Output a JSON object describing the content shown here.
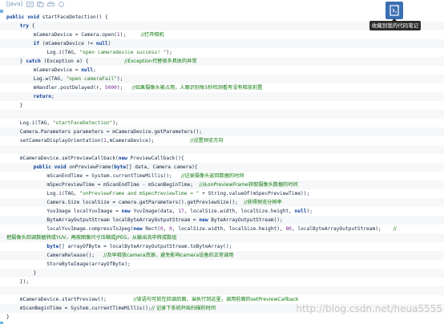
{
  "toolbar": {
    "lang_tag": "[java]",
    "icons": [
      "view-plain-icon",
      "copy-icon",
      "print-icon",
      "help-icon"
    ]
  },
  "collect": {
    "icon": "collect-code-icon",
    "tooltip": "收藏到我的代码笔记"
  },
  "watermark": "http://blog.csdn.net/heua5555",
  "code_lines": [
    {
      "indent": 0,
      "tokens": [
        [
          "kw",
          "public "
        ],
        [
          "kw",
          "void "
        ],
        [
          "pl",
          "startFaceDetection() {"
        ]
      ]
    },
    {
      "indent": 4,
      "tokens": [
        [
          "kw",
          "try "
        ],
        [
          "pl",
          "{"
        ]
      ]
    },
    {
      "indent": 8,
      "tokens": [
        [
          "pl",
          "mCameraDevice = Camera.open("
        ],
        [
          "num",
          "1"
        ],
        [
          "pl",
          ");     "
        ],
        [
          "cm",
          "//打开相机"
        ]
      ]
    },
    {
      "indent": 8,
      "tokens": [
        [
          "kw",
          "if "
        ],
        [
          "pl",
          "(mCameraDevice != "
        ],
        [
          "kw",
          "null"
        ],
        [
          "pl",
          ")"
        ]
      ]
    },
    {
      "indent": 12,
      "tokens": [
        [
          "pl",
          "Log.i(TAG, "
        ],
        [
          "str",
          "\"open cameradevice success! \""
        ],
        [
          "pl",
          ");"
        ]
      ]
    },
    {
      "indent": 4,
      "tokens": [
        [
          "pl",
          "} "
        ],
        [
          "kw",
          "catch "
        ],
        [
          "pl",
          "(Exception e) {            "
        ],
        [
          "cm",
          "//Exception代替很多具体的异常"
        ]
      ]
    },
    {
      "indent": 8,
      "tokens": [
        [
          "pl",
          "mCameraDevice = "
        ],
        [
          "kw",
          "null"
        ],
        [
          "pl",
          ";"
        ]
      ]
    },
    {
      "indent": 8,
      "tokens": [
        [
          "pl",
          "Log.w(TAG, "
        ],
        [
          "str",
          "\"open cameraFail\""
        ],
        [
          "pl",
          ");"
        ]
      ]
    },
    {
      "indent": 8,
      "tokens": [
        [
          "pl",
          "mHandler.postDelayed(r, "
        ],
        [
          "num",
          "5000"
        ],
        [
          "pl",
          ");   "
        ],
        [
          "cm",
          "//如果摄像头被占用，人眼识别每5秒检测看有没有释放前置"
        ]
      ]
    },
    {
      "indent": 8,
      "tokens": [
        [
          "kw",
          "return"
        ],
        [
          "pl",
          ";"
        ]
      ]
    },
    {
      "indent": 4,
      "tokens": [
        [
          "pl",
          "}"
        ]
      ]
    },
    {
      "indent": 0,
      "tokens": []
    },
    {
      "indent": 4,
      "tokens": [
        [
          "pl",
          "Log.i(TAG, "
        ],
        [
          "str",
          "\"startFaceDetection\""
        ],
        [
          "pl",
          ");"
        ]
      ]
    },
    {
      "indent": 4,
      "tokens": [
        [
          "pl",
          "Camera.Parameters parameters = mCameraDevice.getParameters();"
        ]
      ]
    },
    {
      "indent": 4,
      "tokens": [
        [
          "pl",
          "setCameraDisplayOrientation("
        ],
        [
          "num",
          "1"
        ],
        [
          "pl",
          ",mCameraDevice);            "
        ],
        [
          "cm",
          "//设置预览方向"
        ]
      ]
    },
    {
      "indent": 0,
      "tokens": []
    },
    {
      "indent": 4,
      "tokens": [
        [
          "pl",
          "mCameraDevice.setPreviewCallback("
        ],
        [
          "kw",
          "new "
        ],
        [
          "pl",
          "PreviewCallback(){"
        ]
      ]
    },
    {
      "indent": 8,
      "tokens": [
        [
          "kw",
          "public "
        ],
        [
          "kw",
          "void "
        ],
        [
          "pl",
          "onPreviewFrame("
        ],
        [
          "kw",
          "byte"
        ],
        [
          "pl",
          "[] data, Camera camera){"
        ]
      ]
    },
    {
      "indent": 12,
      "tokens": [
        [
          "pl",
          "mScanEndTime = System.currentTimeMillis();   "
        ],
        [
          "cm",
          "//记录摄像头返回数据的时间"
        ]
      ]
    },
    {
      "indent": 12,
      "tokens": [
        [
          "pl",
          "mSpecPreviewTime = mScanEndTime - mScanBeginTime;  "
        ],
        [
          "cm",
          "//从onPreviewFrame获取摄像头数据的时间"
        ]
      ]
    },
    {
      "indent": 12,
      "tokens": [
        [
          "pl",
          "Log.i(TAG, "
        ],
        [
          "str",
          "\"onPreviewFrame and mSpecPreviewTime = \""
        ],
        [
          "pl",
          " + String.valueOf(mSpecPreviewTime));"
        ]
      ]
    },
    {
      "indent": 12,
      "tokens": [
        [
          "pl",
          "Camera.Size localSize = camera.getParameters().getPreviewSize();  "
        ],
        [
          "cm",
          "//获得预览分辨率"
        ]
      ]
    },
    {
      "indent": 12,
      "tokens": [
        [
          "pl",
          "YuvImage localYuvImage = "
        ],
        [
          "kw",
          "new "
        ],
        [
          "pl",
          "YuvImage(data, "
        ],
        [
          "num",
          "17"
        ],
        [
          "pl",
          ", localSize.width, localSize.height, "
        ],
        [
          "kw",
          "null"
        ],
        [
          "pl",
          ");"
        ]
      ]
    },
    {
      "indent": 12,
      "tokens": [
        [
          "pl",
          "ByteArrayOutputStream localByteArrayOutputStream = "
        ],
        [
          "kw",
          "new "
        ],
        [
          "pl",
          "ByteArrayOutputStream();"
        ]
      ]
    },
    {
      "indent": 12,
      "tokens": [
        [
          "pl",
          "localYuvImage.compressToJpeg("
        ],
        [
          "kw",
          "new "
        ],
        [
          "pl",
          "Rect("
        ],
        [
          "num",
          "0"
        ],
        [
          "pl",
          ", "
        ],
        [
          "num",
          "0"
        ],
        [
          "pl",
          ", localSize.width, localSize.height), "
        ],
        [
          "num",
          "80"
        ],
        [
          "pl",
          ", localByteArrayOutputStream);    "
        ],
        [
          "cm",
          "//"
        ]
      ]
    },
    {
      "indent": 0,
      "tokens": [
        [
          "cm",
          "把摄像头回调数据转成YUV，再按图像尺寸压缩成JPEG，从输出流中转成数组"
        ]
      ]
    },
    {
      "indent": 12,
      "tokens": [
        [
          "kw",
          "byte"
        ],
        [
          "pl",
          "[] arrayOfByte = localByteArrayOutputStream.toByteArray();"
        ]
      ]
    },
    {
      "indent": 12,
      "tokens": [
        [
          "pl",
          "CameraRelease();   "
        ],
        [
          "cm",
          "//及早释放camera资源，避免影响camera设备的正常调用"
        ]
      ]
    },
    {
      "indent": 12,
      "tokens": [
        [
          "pl",
          "StoreByteImage(arrayOfByte);"
        ]
      ]
    },
    {
      "indent": 8,
      "tokens": [
        [
          "pl",
          "}"
        ]
      ]
    },
    {
      "indent": 4,
      "tokens": [
        [
          "pl",
          "});"
        ]
      ]
    },
    {
      "indent": 0,
      "tokens": []
    },
    {
      "indent": 4,
      "tokens": [
        [
          "pl",
          "mCameraDevice.startPreview();         "
        ],
        [
          "cm",
          "//该语句可放在回调后面，当执行到这里，调用前面的setPreviewCallback"
        ]
      ]
    },
    {
      "indent": 4,
      "tokens": [
        [
          "pl",
          "mScanBeginTime = System.currentTimeMillis();"
        ],
        [
          "cm",
          "// 记录下系统开始扫描的时间"
        ]
      ]
    },
    {
      "indent": 0,
      "tokens": [
        [
          "pl",
          "}"
        ]
      ]
    }
  ]
}
